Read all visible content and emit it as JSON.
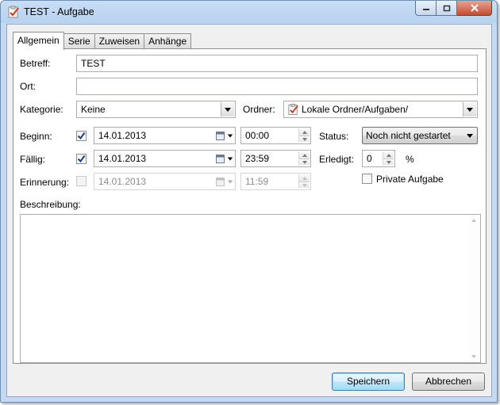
{
  "window": {
    "title": "TEST - Aufgabe"
  },
  "tabs": [
    {
      "label": "Allgemein",
      "active": true
    },
    {
      "label": "Serie",
      "active": false
    },
    {
      "label": "Zuweisen",
      "active": false
    },
    {
      "label": "Anhänge",
      "active": false
    }
  ],
  "form": {
    "subject_label": "Betreff:",
    "subject_value": "TEST",
    "location_label": "Ort:",
    "location_value": "",
    "category_label": "Kategorie:",
    "category_value": "Keine",
    "folder_label": "Ordner:",
    "folder_value": "Lokale Ordner/Aufgaben/",
    "begin": {
      "label": "Beginn:",
      "checked": true,
      "date": "14.01.2013",
      "time": "00:00"
    },
    "due": {
      "label": "Fällig:",
      "checked": true,
      "date": "14.01.2013",
      "time": "23:59"
    },
    "reminder": {
      "label": "Erinnerung:",
      "checked": false,
      "date": "14.01.2013",
      "time": "11:59"
    },
    "status_label": "Status:",
    "status_value": "Noch nicht gestartet",
    "done_label": "Erledigt:",
    "done_value": "0",
    "done_unit": "%",
    "private_label": "Private Aufgabe",
    "private_checked": false,
    "description_label": "Beschreibung:",
    "description_value": ""
  },
  "buttons": {
    "save": "Speichern",
    "cancel": "Abbrechen"
  },
  "colors": {
    "title_bar": "#b8d2ef",
    "close_button": "#c74a33",
    "default_button": "#bee6fd",
    "check_mark": "#1f3f8a",
    "task_icon_red": "#cc3322"
  }
}
